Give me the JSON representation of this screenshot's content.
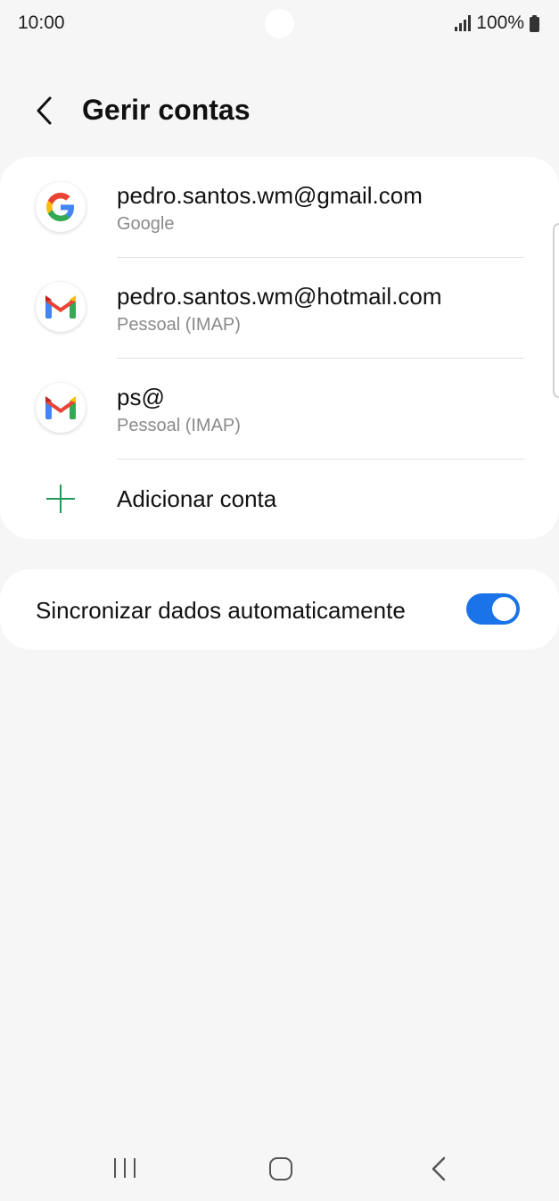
{
  "status_bar": {
    "time": "10:00",
    "battery": "100%",
    "icons": [
      "signal-icon",
      "battery-icon"
    ]
  },
  "header": {
    "title": "Gerir contas",
    "back_icon": "chevron-left-icon"
  },
  "accounts": [
    {
      "email": "pedro.santos.wm@gmail.com",
      "type": "Google",
      "icon": "google-icon"
    },
    {
      "email": "pedro.santos.wm@hotmail.com",
      "type": "Pessoal (IMAP)",
      "icon": "gmail-icon"
    },
    {
      "email": "ps@",
      "type": "Pessoal (IMAP)",
      "icon": "gmail-icon"
    }
  ],
  "add_account": {
    "label": "Adicionar conta",
    "icon": "plus-icon"
  },
  "sync": {
    "label": "Sincronizar dados automaticamente",
    "enabled": true
  },
  "colors": {
    "accent": "#1a73e8",
    "add_icon": "#1e9d5a",
    "background": "#f6f6f6",
    "card": "#ffffff"
  },
  "nav_bar": {
    "icons": [
      "recent-apps-icon",
      "home-icon",
      "back-icon"
    ]
  }
}
